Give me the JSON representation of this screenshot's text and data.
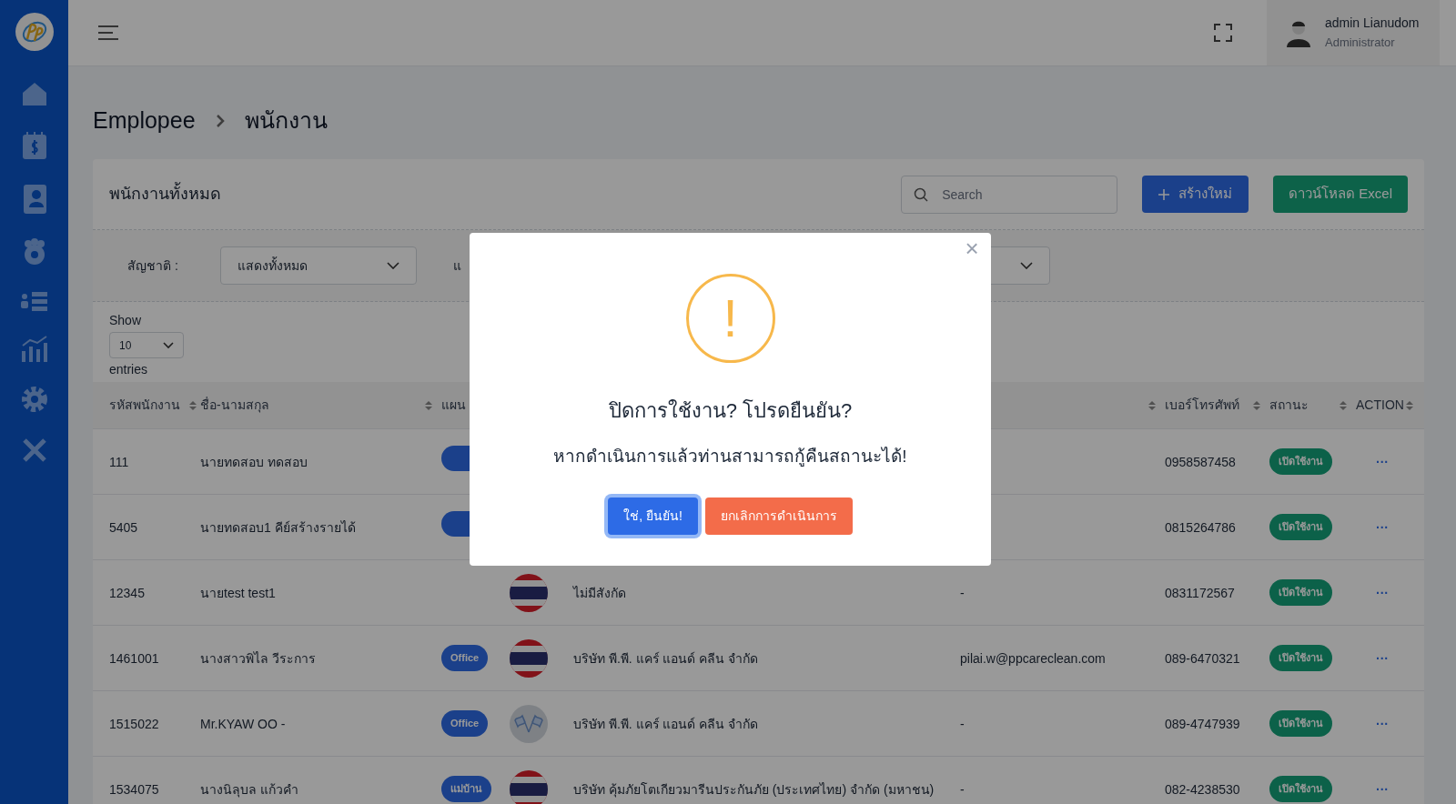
{
  "header": {
    "user_name": "admin Lianudom",
    "user_role": "Administrator"
  },
  "breadcrumb": [
    "Emplopee",
    "พนักงาน"
  ],
  "card": {
    "title": "พนักงานทั้งหมด",
    "search_placeholder": "Search",
    "create_button": "สร้างใหม่",
    "excel_button": "ดาวน์โหลด Excel"
  },
  "filters": [
    {
      "label": "สัญชาติ :",
      "value": "แสดงทั้งหมด"
    },
    {
      "label": "แ"
    }
  ],
  "show": {
    "label": "Show",
    "value": "10",
    "suffix": "entries"
  },
  "table": {
    "columns": [
      "รหัสพนักงาน",
      "ชื่อ-นามสกุล",
      "แผน",
      "เบอร์โทรศัพท์",
      "สถานะ",
      "ACTION"
    ],
    "rows": [
      {
        "id": "111",
        "name": "นายทดสอบ ทดสอบ",
        "phone": "0958587458",
        "status": "เปิดใช้งาน",
        "action": "···"
      },
      {
        "id": "5405",
        "name": "นายทดสอบ1 คีย์สร้างรายได้",
        "phone": "0815264786",
        "status": "เปิดใช้งาน",
        "action": "···"
      },
      {
        "id": "12345",
        "name": "นายtest test1",
        "flag": {
          "kind": "thai"
        },
        "company": "ไม่มีสังกัด",
        "email": "-",
        "phone": "0831172567",
        "status": "เปิดใช้งาน",
        "action": "···"
      },
      {
        "id": "1461001",
        "name": "นางสาวพิไล วีระการ",
        "department": "Office",
        "flag": {
          "kind": "thai"
        },
        "company": "บริษัท พี.พี. แคร์ แอนด์ คลีน จำกัด",
        "email": "pilai.w@ppcareclean.com",
        "phone": "089-6470321",
        "status": "เปิดใช้งาน",
        "action": "···"
      },
      {
        "id": "1515022",
        "name": "Mr.KYAW OO -",
        "department": "Office",
        "flag": {
          "kind": "generic"
        },
        "company": "บริษัท พี.พี. แคร์ แอนด์ คลีน จำกัด",
        "email": "-",
        "phone": "089-4747939",
        "status": "เปิดใช้งาน",
        "action": "···"
      },
      {
        "id": "1534075",
        "name": "นางนิลุบล แก้วคำ",
        "department": "แม่บ้าน",
        "flag": {
          "kind": "thai"
        },
        "company": "บริษัท คุ้มภัยโตเกียวมารีนประกันภัย (ประเทศไทย) จำกัด (มหาชน)",
        "email": "-",
        "phone": "082-4238530",
        "status": "เปิดใช้งาน",
        "action": "···"
      }
    ]
  },
  "dialog": {
    "title": "ปิดการใช้งาน? โปรดยืนยัน?",
    "message": "หากดำเนินการแล้วท่านสามารถกู้คืนสถานะได้!",
    "confirm": "ใช่, ยืนยัน!",
    "cancel": "ยกเลิกการดำเนินการ",
    "close": "×",
    "icon": "!"
  }
}
